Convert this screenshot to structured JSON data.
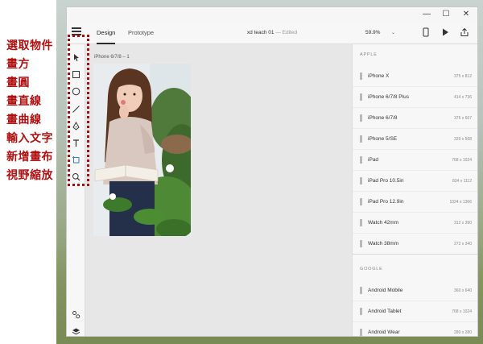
{
  "annotations": [
    "選取物件",
    "畫方",
    "畫圓",
    "畫直線",
    "畫曲線",
    "輸入文字",
    "新增畫布",
    "視野縮放"
  ],
  "window": {
    "minimize": "—",
    "maximize": "☐",
    "close": "✕"
  },
  "appbar": {
    "tabs": [
      {
        "label": "Design",
        "active": true
      },
      {
        "label": "Prototype",
        "active": false
      }
    ],
    "doc_name": "xd teach 01",
    "doc_sep": "—",
    "doc_status": "Edited",
    "zoom": "59.9%"
  },
  "toolbar": {
    "tools": [
      "select-tool",
      "rectangle-tool",
      "ellipse-tool",
      "line-tool",
      "pen-tool",
      "text-tool",
      "artboard-tool",
      "zoom-tool"
    ],
    "bottom": [
      "symbols-icon",
      "layers-icon"
    ]
  },
  "canvas": {
    "artboard_label": "iPhone 6/7/8 – 1"
  },
  "panel": {
    "apple_heading": "APPLE",
    "apple_devices": [
      {
        "name": "iPhone X",
        "size": "375 x 812"
      },
      {
        "name": "iPhone 6/7/8 Plus",
        "size": "414 x 736"
      },
      {
        "name": "iPhone 6/7/8",
        "size": "375 x 667"
      },
      {
        "name": "iPhone 5/SE",
        "size": "320 x 568"
      },
      {
        "name": "iPad",
        "size": "768 x 1024"
      },
      {
        "name": "iPad Pro 10.5in",
        "size": "834 x 1112"
      },
      {
        "name": "iPad Pro 12.9in",
        "size": "1024 x 1366"
      },
      {
        "name": "Watch 42mm",
        "size": "312 x 390"
      },
      {
        "name": "Watch 38mm",
        "size": "272 x 340"
      }
    ],
    "google_heading": "GOOGLE",
    "google_devices": [
      {
        "name": "Android Mobile",
        "size": "360 x 640"
      },
      {
        "name": "Android Tablet",
        "size": "768 x 1024"
      },
      {
        "name": "Android Wear",
        "size": "280 x 280"
      }
    ]
  },
  "colors": {
    "annotation_red": "#b01010",
    "active_tab": "#2c2c2c"
  }
}
